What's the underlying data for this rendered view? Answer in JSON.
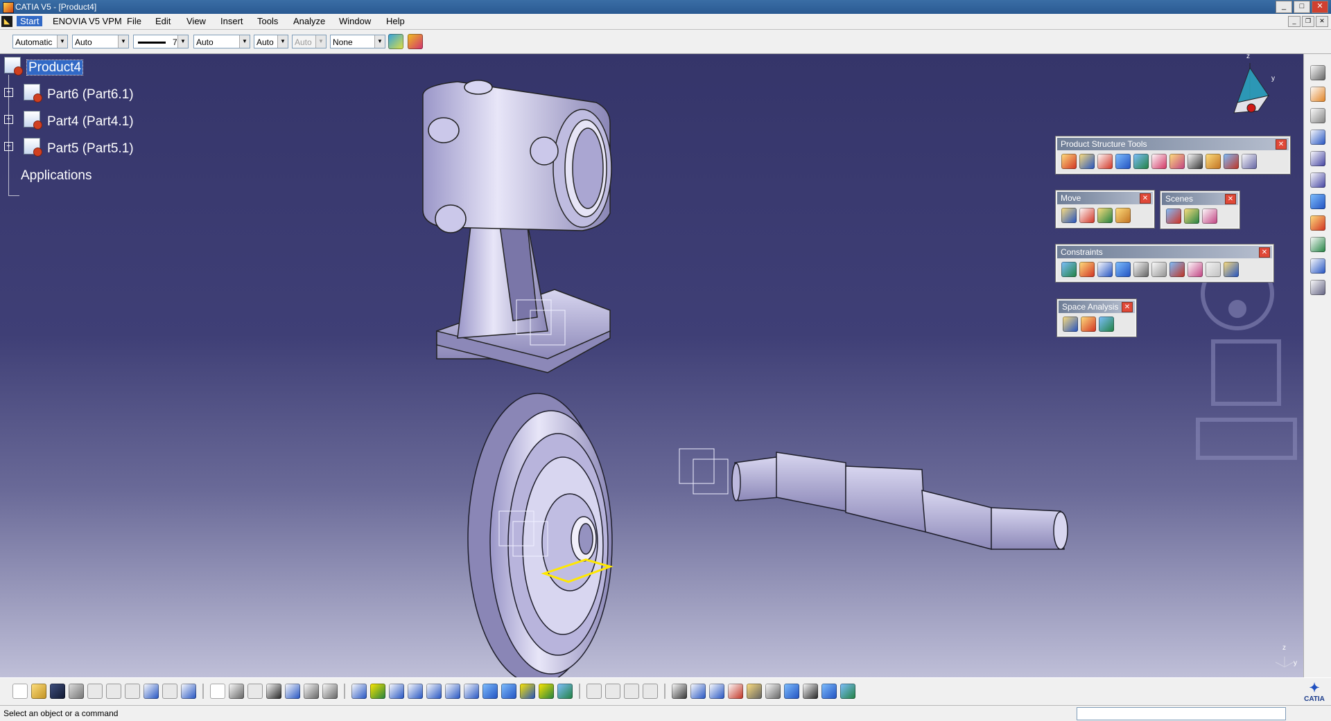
{
  "window": {
    "title": "CATIA V5 - [Product4]"
  },
  "menu": {
    "start": "Start",
    "items": [
      "ENOVIA V5 VPM",
      "File",
      "Edit",
      "View",
      "Insert",
      "Tools",
      "Analyze",
      "Window",
      "Help"
    ]
  },
  "graphic_properties": {
    "color": "Automatic",
    "transparency": "Auto",
    "line_weight": "7",
    "line_type": "Auto",
    "point_symbol": "Auto",
    "rendering_style": "Auto",
    "layer": "None"
  },
  "tree": {
    "root": "Product4",
    "children": [
      "Part6 (Part6.1)",
      "Part4 (Part4.1)",
      "Part5 (Part5.1)"
    ],
    "applications": "Applications"
  },
  "palettes": {
    "product_structure_tools": {
      "title": "Product Structure Tools",
      "icon_count": 11
    },
    "move": {
      "title": "Move",
      "icon_count": 4
    },
    "scenes": {
      "title": "Scenes",
      "icon_count": 3
    },
    "constraints": {
      "title": "Constraints",
      "icon_count": 10
    },
    "space_analysis": {
      "title": "Space Analysis",
      "icon_count": 3
    }
  },
  "compass": {
    "z": "z",
    "y": "y"
  },
  "axis": {
    "z": "z",
    "y": "y"
  },
  "status": {
    "message": "Select an object or a command"
  },
  "logo": {
    "text": "CATIA"
  }
}
